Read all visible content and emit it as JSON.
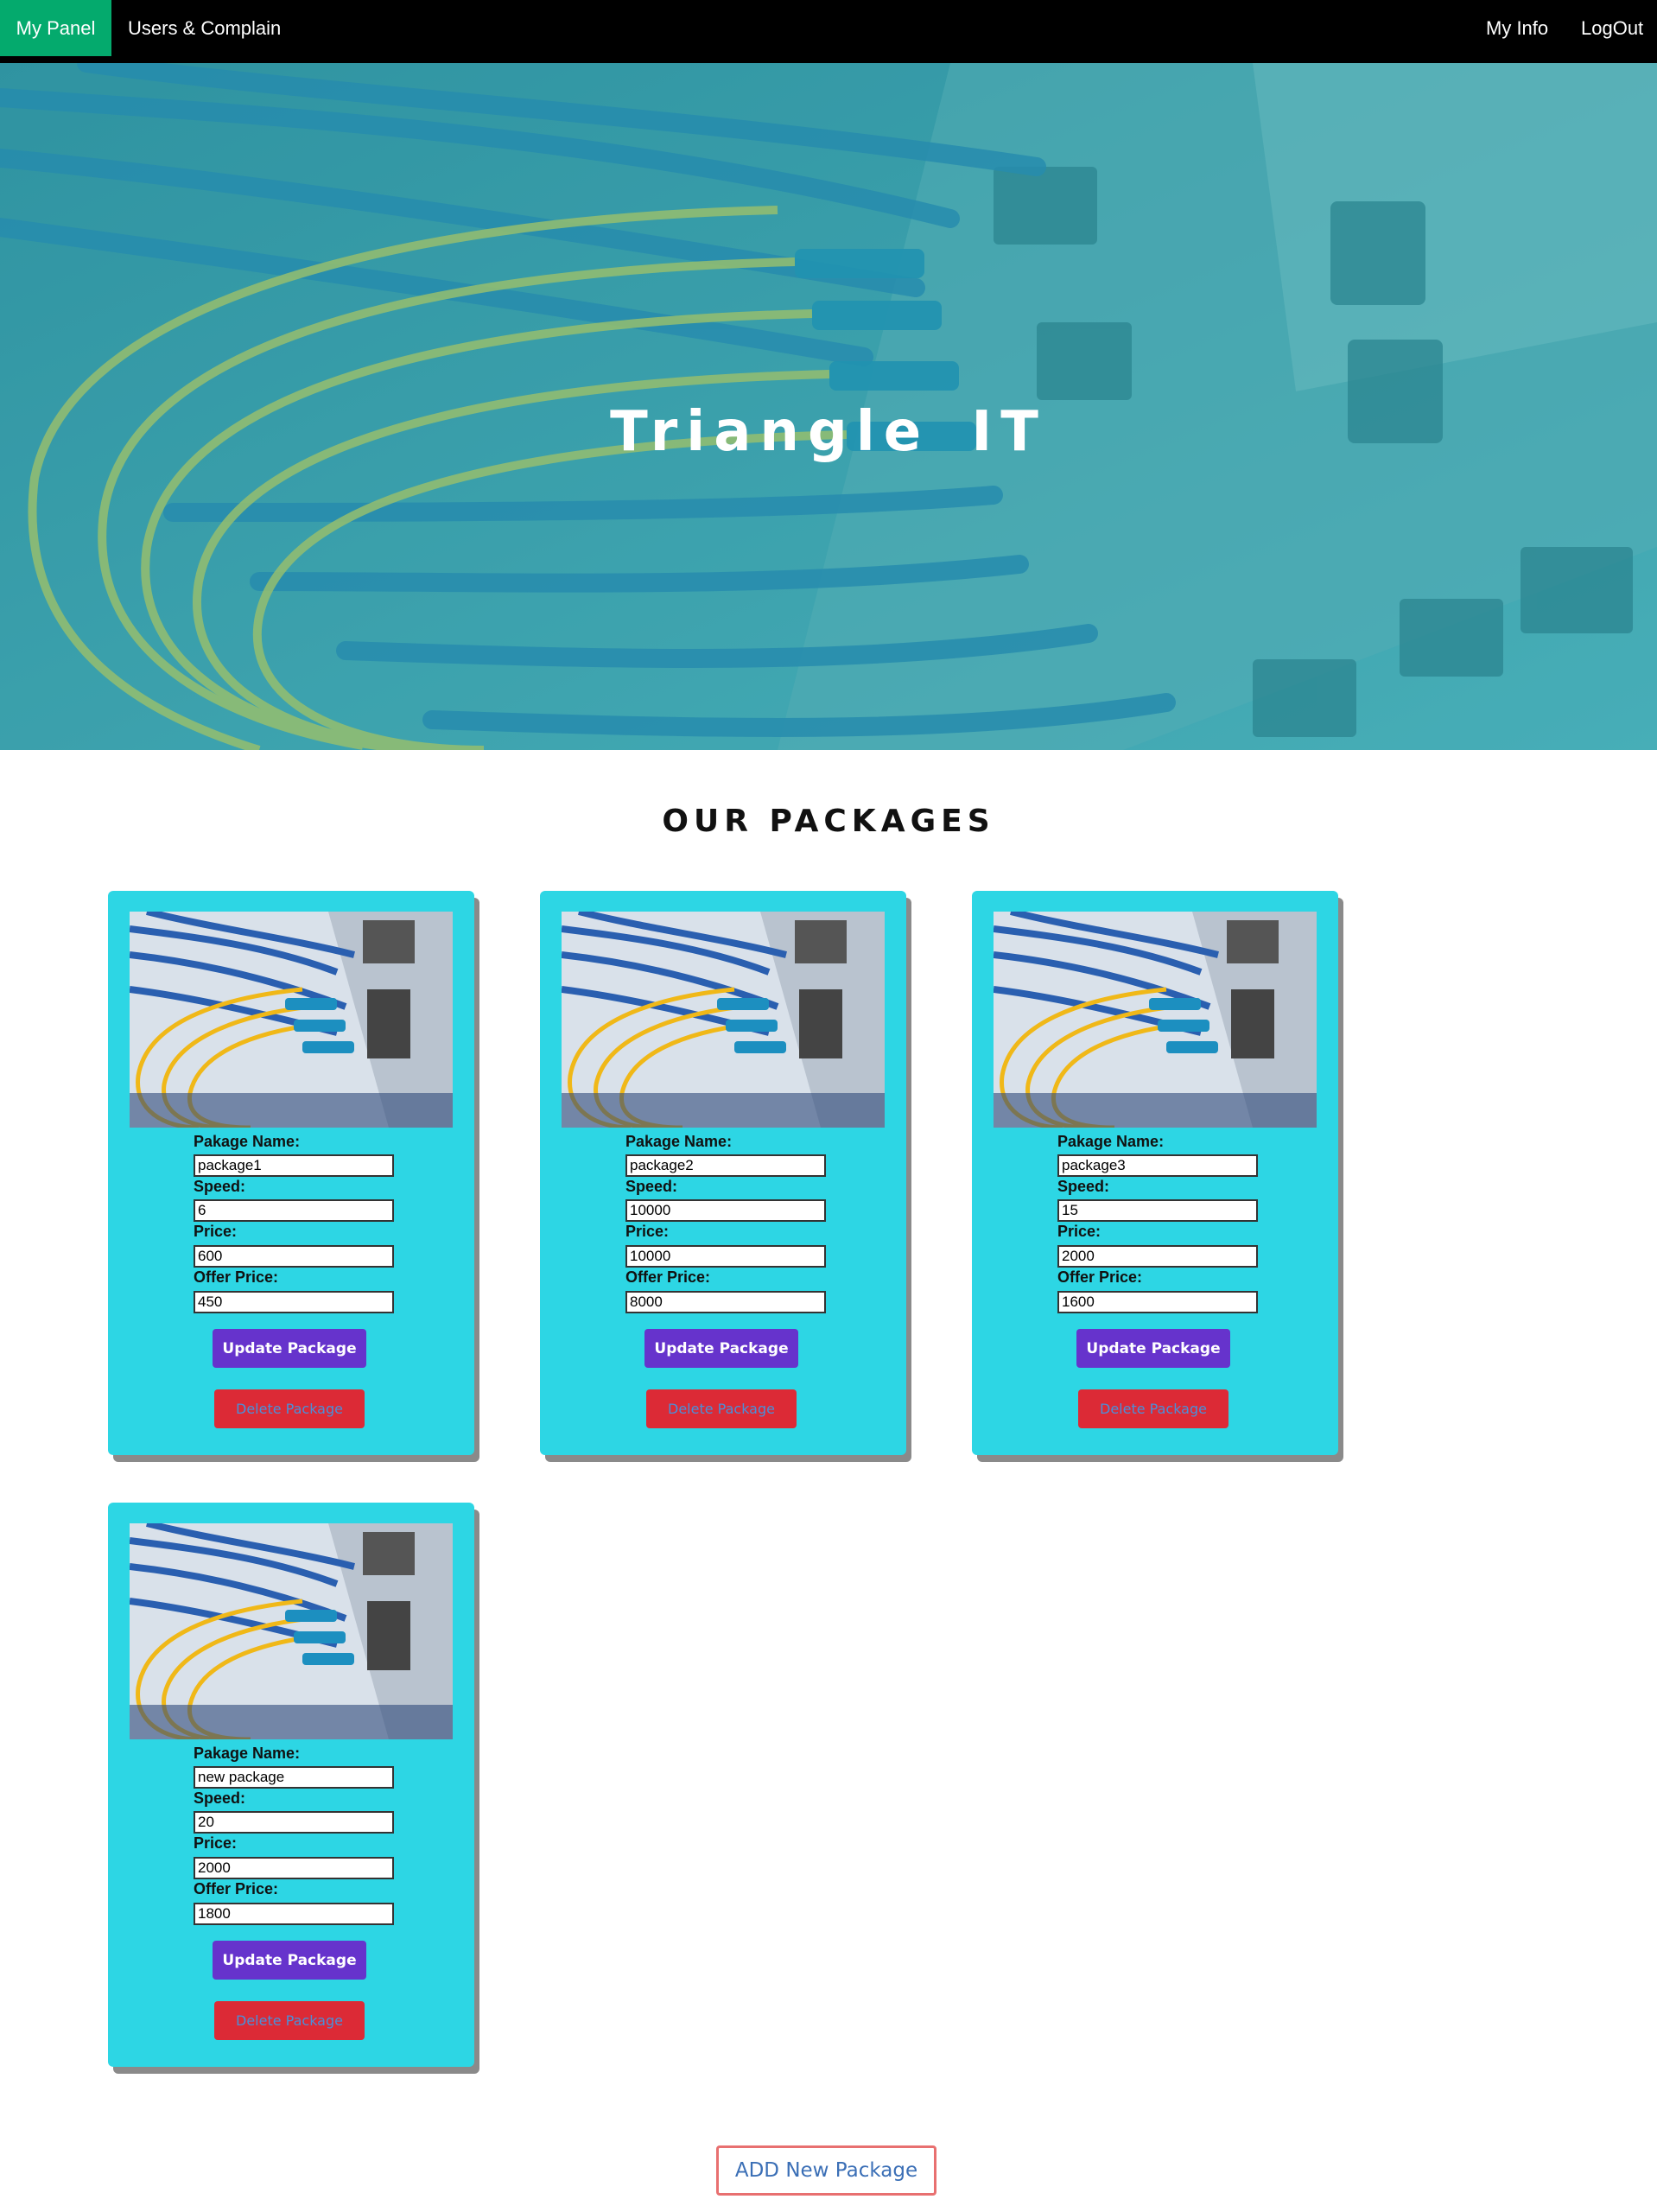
{
  "nav": {
    "my_panel": "My Panel",
    "users_complain": "Users & Complain",
    "my_info": "My Info",
    "logout": "LogOut"
  },
  "hero": {
    "title": "Triangle IT"
  },
  "section": {
    "title": "OUR PACKAGES"
  },
  "labels": {
    "name": "Pakage Name:",
    "speed": "Speed:",
    "price": "Price:",
    "offer_price": "Offer Price:",
    "update_button": "Update Package",
    "delete_button": "Delete Package"
  },
  "packages": [
    {
      "name": "package1",
      "speed": "6",
      "price": "600",
      "offer_price": "450"
    },
    {
      "name": "package2",
      "speed": "10000",
      "price": "10000",
      "offer_price": "8000"
    },
    {
      "name": "package3",
      "speed": "15",
      "price": "2000",
      "offer_price": "1600"
    },
    {
      "name": "new package",
      "speed": "20",
      "price": "2000",
      "offer_price": "1800"
    }
  ],
  "add_button": "ADD New Package",
  "colors": {
    "nav_bg": "#000000",
    "nav_active": "#04AA6D",
    "card_bg": "#2dd6e4",
    "update_btn": "#6633cc",
    "delete_btn": "#dc2a36",
    "add_btn_border": "#e87070"
  }
}
